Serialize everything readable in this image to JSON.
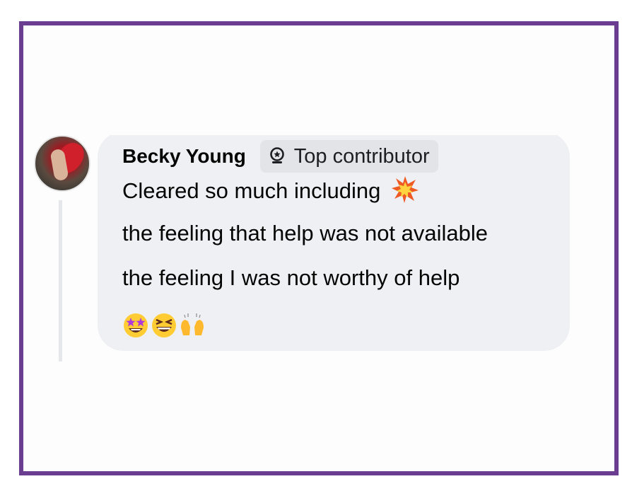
{
  "comment": {
    "author": "Becky Young",
    "badge": "Top contributor",
    "lines": [
      "Cleared so much including",
      "the feeling that help was not available",
      "the feeling I was not worthy of help"
    ],
    "emojis": [
      "star-struck",
      "laughing",
      "raising-hands"
    ]
  },
  "colors": {
    "frame": "#6a3d90",
    "bubble": "#eff0f3",
    "badge": "#e3e4e8",
    "text": "#050505"
  }
}
